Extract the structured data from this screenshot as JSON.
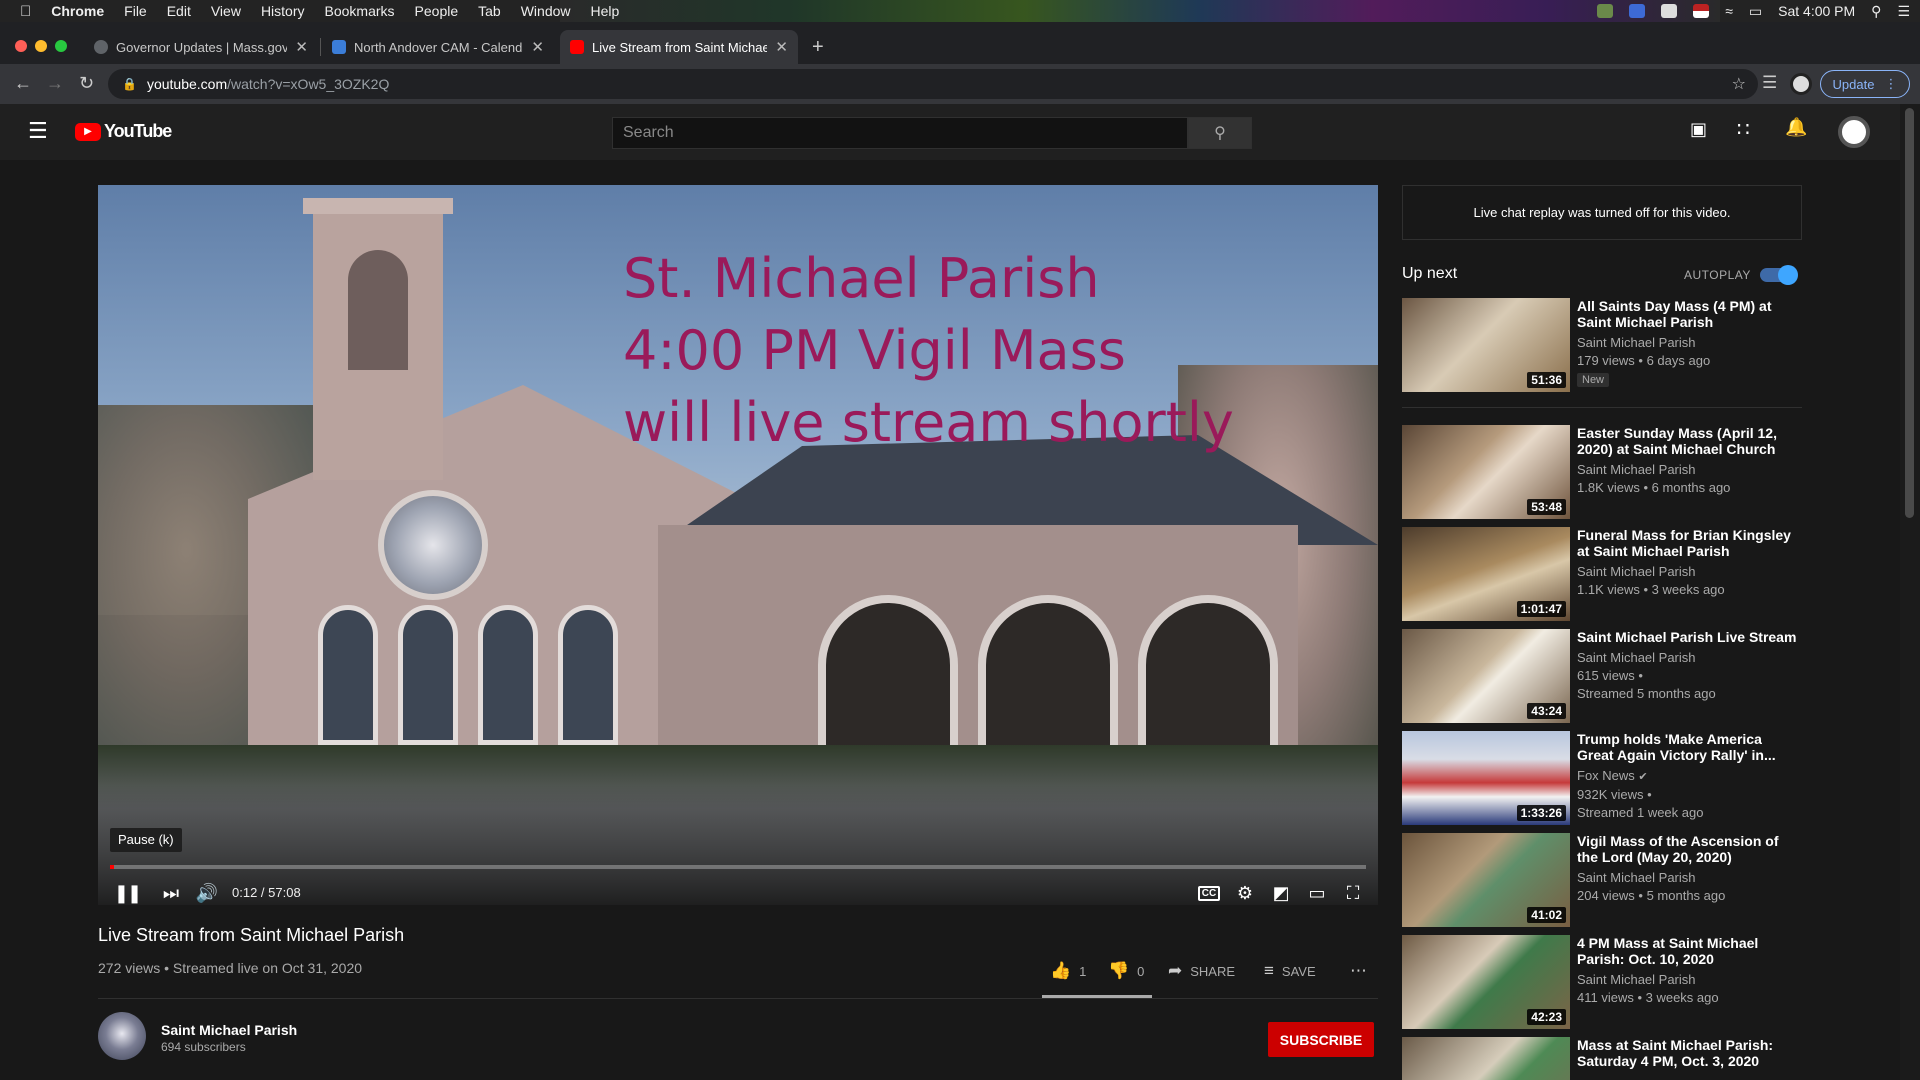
{
  "mac_menu": {
    "app": "Chrome",
    "items": [
      "File",
      "Edit",
      "View",
      "History",
      "Bookmarks",
      "People",
      "Tab",
      "Window",
      "Help"
    ],
    "clock": "Sat 4:00 PM"
  },
  "tabs": [
    {
      "title": "Governor Updates | Mass.gov",
      "active": false,
      "favicon_color": "#5f6368"
    },
    {
      "title": "North Andover CAM - Calenda",
      "active": false,
      "favicon_color": "#3b7dd8"
    },
    {
      "title": "Live Stream from Saint Michae",
      "active": true,
      "favicon_color": "#ff0000"
    }
  ],
  "omnibox": {
    "domain": "youtube.com",
    "path": "/watch?v=xOw5_3OZK2Q"
  },
  "browser": {
    "update_label": "Update"
  },
  "youtube": {
    "logo_text": "YouTube",
    "search_placeholder": "Search"
  },
  "video": {
    "overlay_lines": [
      "St. Michael Parish",
      "4:00 PM Vigil Mass",
      "will live stream shortly"
    ],
    "tooltip": "Pause (k)",
    "time": "0:12 / 57:08",
    "progress": 0.0035,
    "title": "Live Stream from Saint Michael Parish",
    "meta": "272 views • Streamed live on Oct 31, 2020",
    "likes": "1",
    "dislikes": "0",
    "like_ratio": 1.0,
    "share_label": "SHARE",
    "save_label": "SAVE"
  },
  "channel": {
    "name": "Saint Michael Parish",
    "subscribers": "694 subscribers",
    "subscribe_label": "SUBSCRIBE"
  },
  "sidebar": {
    "chat_notice": "Live chat replay was turned off for this video.",
    "up_next": "Up next",
    "autoplay_label": "AUTOPLAY",
    "autoplay_on": true,
    "recommendations": [
      {
        "title": "All Saints Day Mass (4 PM) at Saint Michael Parish",
        "channel": "Saint Michael Parish",
        "views": "179 views • 6 days ago",
        "badge": "New",
        "duration": "51:36"
      },
      {
        "title": "Easter Sunday Mass (April 12, 2020) at Saint Michael Church",
        "channel": "Saint Michael Parish",
        "views": "1.8K views • 6 months ago",
        "duration": "53:48"
      },
      {
        "title": "Funeral Mass for Brian Kingsley at Saint Michael Parish",
        "channel": "Saint Michael Parish",
        "views": "1.1K views • 3 weeks ago",
        "duration": "1:01:47"
      },
      {
        "title": "Saint Michael Parish Live Stream",
        "channel": "Saint Michael Parish",
        "views": "615 views •",
        "views2": "Streamed 5 months ago",
        "duration": "43:24"
      },
      {
        "title": "Trump holds 'Make America Great Again Victory Rally' in...",
        "channel": "Fox News",
        "views": "932K views •",
        "views2": "Streamed 1 week ago",
        "duration": "1:33:26"
      },
      {
        "title": "Vigil Mass of the Ascension of the Lord (May 20, 2020)",
        "channel": "Saint Michael Parish",
        "views": "204 views • 5 months ago",
        "duration": "41:02"
      },
      {
        "title": "4 PM Mass at Saint Michael Parish: Oct. 10, 2020",
        "channel": "Saint Michael Parish",
        "views": "411 views • 3 weeks ago",
        "duration": "42:23"
      },
      {
        "title": "Mass at Saint Michael Parish: Saturday 4 PM, Oct. 3, 2020",
        "channel": "",
        "views": "",
        "duration": ""
      }
    ]
  }
}
